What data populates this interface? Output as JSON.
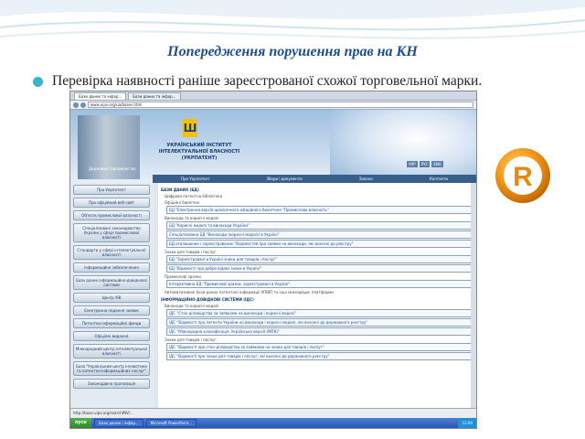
{
  "slide": {
    "title": "Попередження порушення прав на КН",
    "bullet": "Перевірка наявності раніше зареєстрованої  схожої торговельної марки."
  },
  "screenshot": {
    "tabs": [
      "Бази даних та інфор...",
      "Бази даних та інфор..."
    ],
    "address": "www.uipv.org/ua/bases.html",
    "header": {
      "building_caption": "Державне підприємство",
      "institute": "УКРАЇНСЬКИЙ ІНСТИТУТ ІНТЕЛЕКТУАЛЬНОЇ ВЛАСНОСТІ (УКРПАТЕНТ)",
      "languages": [
        "УКР",
        "РУС",
        "ENG"
      ],
      "menu": [
        "Про Укрпатент",
        "Збори і документи",
        "Закони",
        "Контакти"
      ]
    },
    "sidebar": [
      "Про Укрпатент",
      "Про офіційний веб-сайт",
      "Об'єкти промислової власності",
      "Спеціалізовані законодавство України у сфері промислової власності",
      "Стандарти у сфері інтелектуальної власності",
      "Інформаційне забезпечення",
      "Бази даних інформаційно-довідкової системи",
      "Центр УІВ",
      "Електронна подання заявок",
      "Патентно-інформаційні фонди",
      "Офіційні видання",
      "Міжнародний центр інтелектуальної власності",
      "База \"Український центр інноватики та патентно-інформаційних послуг\"",
      "Законодавча пропозиція"
    ],
    "content": {
      "heading": "БАЗИ ДАНИХ (БД)",
      "sub": "Цифрова патентна бібліотека",
      "sub2": "Офіційні бюлетені",
      "top_link": "БД \"Електронна версія щомісячного офіційного бюлетеня \"Промислова власність\"",
      "group1": "Винаходи та корисні моделі",
      "links1": [
        "БД \"Корисні моделі та винаходи України\"",
        "Спеціалізована БД \"Винаходи (корисні моделі) в Україні\"",
        "БД оголошених і зареєстрованих \"Відомостей про заявки на винаходи, які внесені до реєстру\""
      ],
      "group2": "Знаки для товарів і послуг",
      "links2": [
        "БД \"Зареєстровані в Україні знаки для товарів і послуг\"",
        "БД \"Відомості про добре відомі знаки в Україні\""
      ],
      "group3": "Промислові зразки",
      "links3": [
        "Інтерактивна БД \"Промислові зразки, зареєстровані в Україні\""
      ],
      "note": "Автоматизовані бази даних патентної інформації УПІВП та інші міжнародні платформи",
      "heading2": "ІНФОРМАЦІЙНО-ДОВІДКОВІ СИСТЕМИ (ІДС)",
      "group4": "Винаходи та корисні моделі",
      "links4": [
        "ІДС \"Стан діловодства за заявками на винаходи і корисні моделі\"",
        "ІДС \"Відомості про патенти України на винаходи і корисні моделі, які внесені до державного реєстру\"",
        "ІДС \"Міжнародна класифікація. Українська версія (МПК)\""
      ],
      "group5": "Знаки для товарів і послуг",
      "links5": [
        "ІДС \"Відомості про стан діловодства за заявками на знаки для товарів і послуг\"",
        "ІДС \"Відомості про знаки для товарів і послуг, які внесені до державного реєстру\""
      ]
    },
    "status_url": "http://base.uipv.org/searchINV/...",
    "taskbar": {
      "start": "пуск",
      "tasks": [
        "Бази даних і інфор...",
        "Microsoft PowerPoint..."
      ],
      "clock": "12:00"
    }
  },
  "registered_mark": "R"
}
